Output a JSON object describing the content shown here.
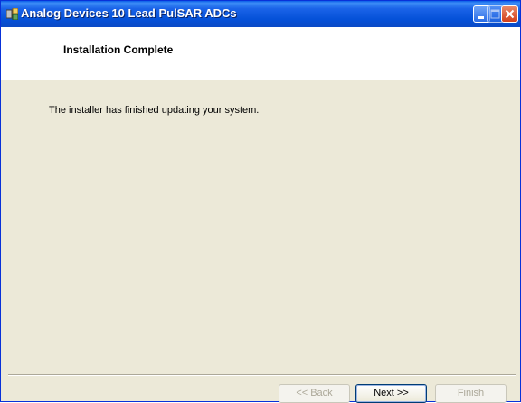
{
  "window": {
    "title": "Analog Devices 10 Lead PulSAR ADCs",
    "app_icon": "installer-icon",
    "controls": [
      "minimize",
      "maximize",
      "close"
    ]
  },
  "header": {
    "title": "Installation Complete"
  },
  "body": {
    "message": "The installer has finished updating your system."
  },
  "footer": {
    "back_label": "<< Back",
    "back_enabled": false,
    "next_label": "Next >>",
    "next_enabled": true,
    "finish_label": "Finish",
    "finish_enabled": false
  },
  "colors": {
    "titlebar": "#0551d8",
    "window_bg": "#ece9d8",
    "header_bg": "#ffffff"
  }
}
